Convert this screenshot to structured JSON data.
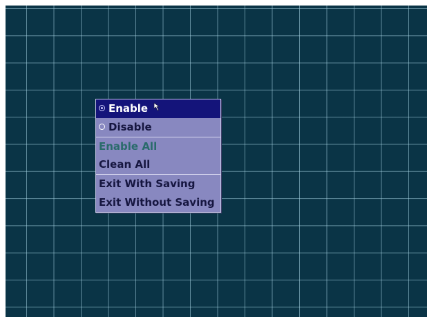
{
  "menu": {
    "items": [
      {
        "label": "Enable",
        "state": "selected",
        "radio": "checked"
      },
      {
        "label": "Disable",
        "state": "normal",
        "radio": "unchecked"
      },
      {
        "label": "Enable All",
        "state": "disabled"
      },
      {
        "label": "Clean All",
        "state": "normal"
      },
      {
        "label": "Exit With Saving",
        "state": "normal"
      },
      {
        "label": "Exit Without Saving",
        "state": "normal"
      }
    ]
  },
  "colors": {
    "background": "#0a3446",
    "grid_line": "#aad7e6",
    "menu_bg": "#8888c0",
    "selected_bg": "#14147a",
    "disabled_text": "#2a6b6b"
  },
  "icons": {
    "pointer": "mouse-pointer-icon",
    "radio_checked": "radio-checked-icon",
    "radio_unchecked": "radio-unchecked-icon"
  }
}
